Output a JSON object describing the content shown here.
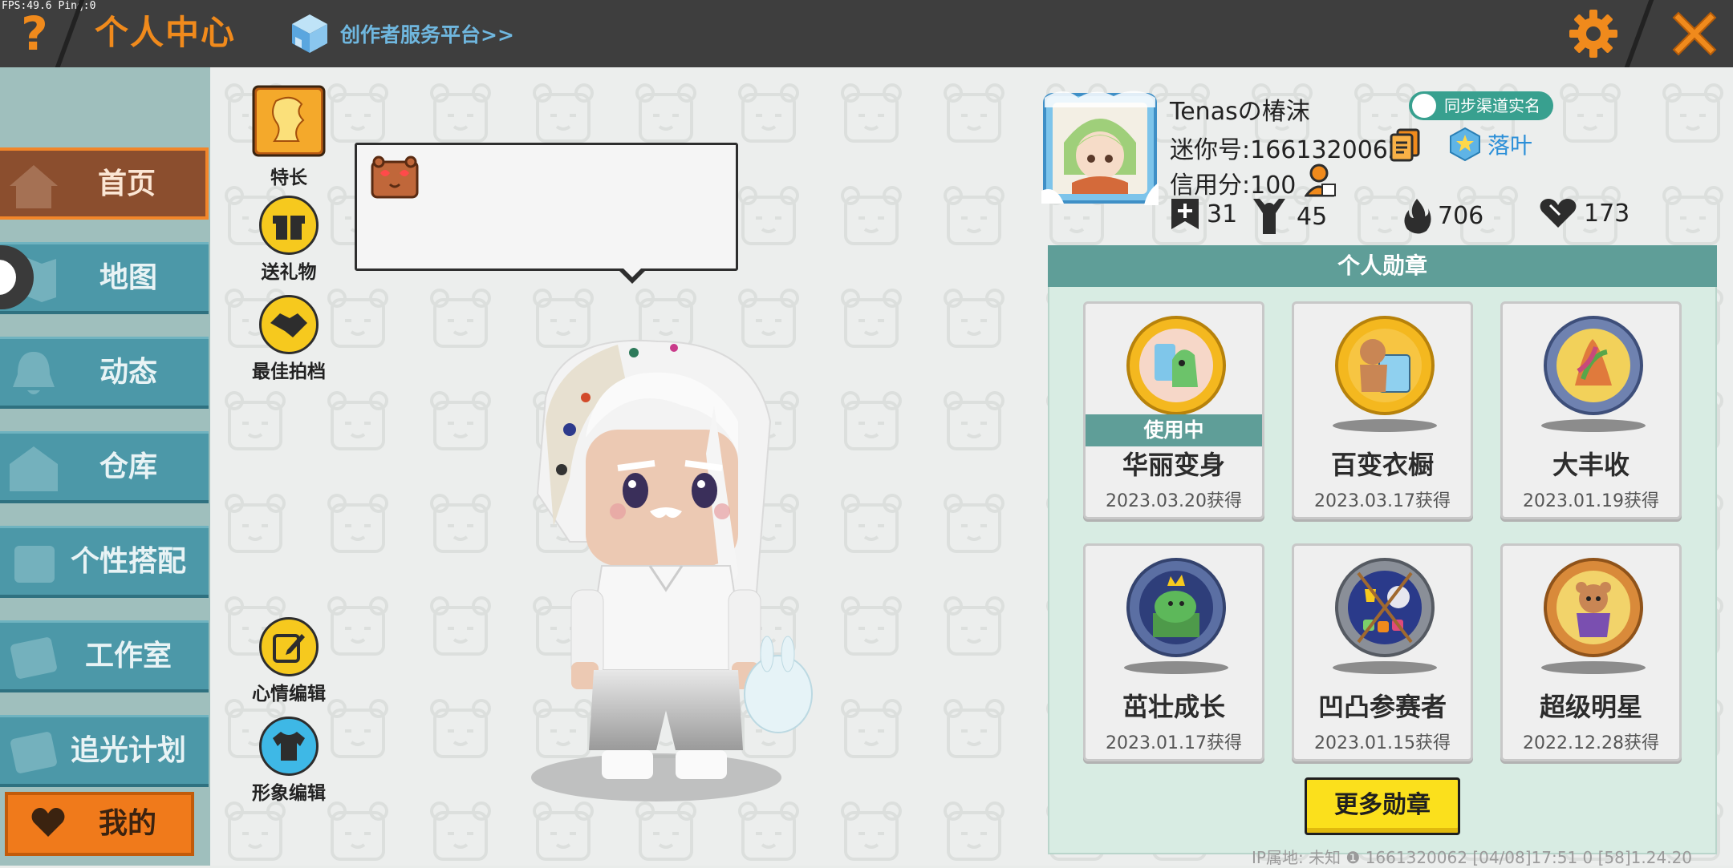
{
  "debug": {
    "fps_text": "FPS:49.6  Ping:0"
  },
  "header": {
    "help_label": "?",
    "title": "个人中心",
    "creator_link": "创作者服务平台>>"
  },
  "sidebar": {
    "items": [
      {
        "label": "首页",
        "icon": "home-icon",
        "active": true
      },
      {
        "label": "地图",
        "icon": "map-icon"
      },
      {
        "label": "动态",
        "icon": "bell-icon"
      },
      {
        "label": "仓库",
        "icon": "warehouse-icon"
      },
      {
        "label": "个性搭配",
        "icon": "outfit-icon"
      },
      {
        "label": "工作室",
        "icon": "studio-icon"
      },
      {
        "label": "追光计划",
        "icon": "spotlight-icon"
      }
    ],
    "mine_label": "我的"
  },
  "actions": {
    "specialty": "特长",
    "gift": "送礼物",
    "best_partner": "最佳拍档",
    "mood_edit": "心情编辑",
    "look_edit": "形象编辑"
  },
  "profile": {
    "name": "Tenasの椿沫",
    "mini_id": "迷你号:1661320062",
    "credit": "信用分:100",
    "sync_label": "同步渠道实名",
    "guild": "落叶",
    "stats": {
      "plus": "31",
      "fans": "45",
      "heat": "706",
      "likes": "173"
    }
  },
  "medals": {
    "header": "个人勋章",
    "in_use_label": "使用中",
    "items": [
      {
        "name": "华丽变身",
        "date": "2023.03.20获得",
        "in_use": true,
        "color": "#f4b81f"
      },
      {
        "name": "百变衣橱",
        "date": "2023.03.17获得",
        "color": "#f4b81f"
      },
      {
        "name": "大丰收",
        "date": "2023.01.19获得",
        "color": "#6f82b0"
      },
      {
        "name": "茁壮成长",
        "date": "2023.01.17获得",
        "color": "#5b6fa3"
      },
      {
        "name": "凹凸参赛者",
        "date": "2023.01.15获得",
        "color": "#8a8f98"
      },
      {
        "name": "超级明星",
        "date": "2022.12.28获得",
        "color": "#d98a3a"
      }
    ],
    "more_label": "更多勋章"
  },
  "footer": {
    "text": "IP属地: 未知 ❶   1661320062    [04/08]17:51 0   [58]1.24.20"
  },
  "colors": {
    "accent": "#f08a1c",
    "teal": "#5f9e98",
    "sidebar": "#4c98a8"
  }
}
